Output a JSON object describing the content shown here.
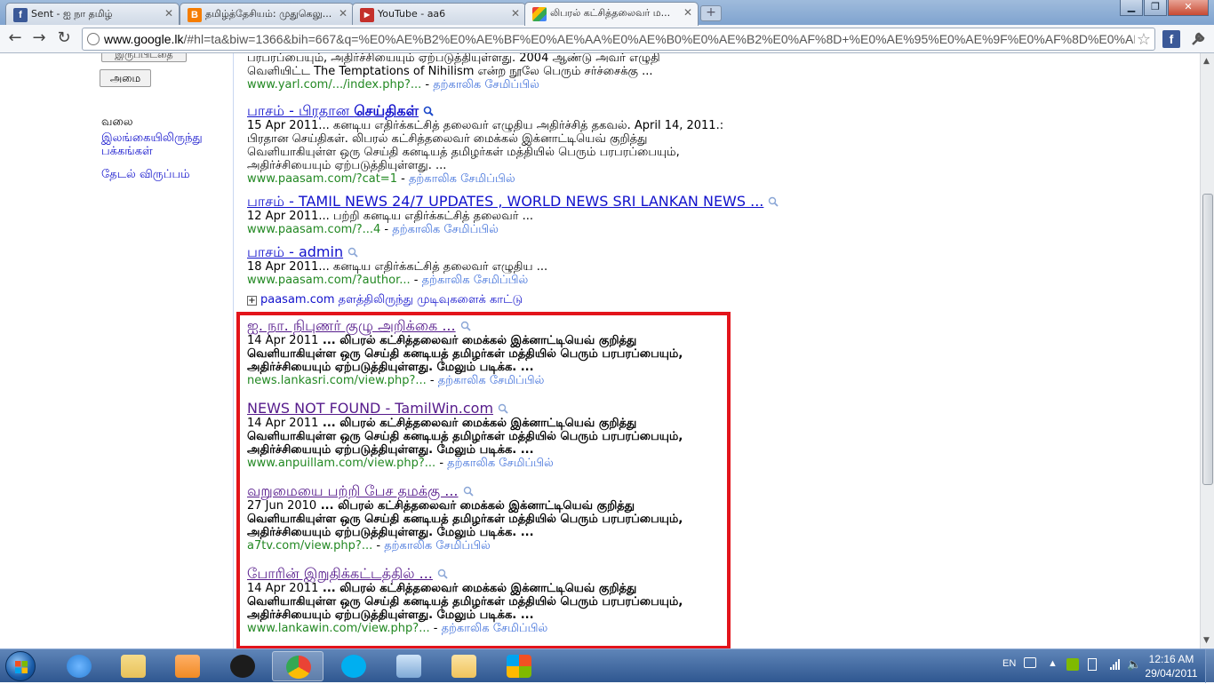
{
  "tabs": [
    {
      "title": "Sent - ஐ நா தமிழ்",
      "favicon": "facebook-icon",
      "color": "#3b5998",
      "glyph": "f"
    },
    {
      "title": "தமிழ்த்தேசியம்: முதுகெலு...",
      "favicon": "blogger-icon",
      "color": "#f57d00",
      "glyph": "B"
    },
    {
      "title": "YouTube - aa6",
      "favicon": "youtube-icon",
      "color": "#c4302b",
      "glyph": "▶"
    },
    {
      "title": "லிபரல் கட்சித்தலைவர் ம...",
      "favicon": "google-icon",
      "color": "#3b82f6",
      "glyph": "g"
    }
  ],
  "address": {
    "host": "www.google.lk",
    "path": "/#hl=ta&biw=1366&bih=667&q=%E0%AE%B2%E0%AE%BF%E0%AE%AA%E0%AE%B0%E0%AE%B2%E0%AF%8D+%E0%AE%95%E0%AE%9F%E0%AF%8D%E0%AE%"
  },
  "sidebar": {
    "partial_label": "இருப்பிடதை",
    "set_button": "அமை",
    "web_heading": "வலை",
    "links": [
      "இலங்கையிலிருந்து பக்கங்கள்",
      "தேடல் விருப்பம்"
    ]
  },
  "cached_label": "தற்காலிக சேமிப்பில்",
  "top_partial": {
    "line1": "பரபரப்பையும், அதிர்ச்சியையும் ஏற்படுத்தியுள்ளது. 2004 ஆண்டு அவர் எழுதி",
    "line2": "வெளியிட்ட The Temptations of Nihilism என்ற நூலே பெரும் சர்ச்சைக்கு ...",
    "cite": "www.yarl.com/.../index.php?..."
  },
  "results": [
    {
      "title_plain": "பாசம் - பிரதான ",
      "title_bold": "செய்திகள்",
      "snippet": "15 Apr 2011... கனடிய எதிர்க்கட்சித் தலைவர் எழுதிய அதிர்ச்சித் தகவல். April 14, 2011.: பிரதான செய்திகள். லிபரல் கட்சித்தலைவர் மைக்கல் இக்னாட்டியெவ் குறித்து வெளியாகியுள்ள ஒரு செய்தி கனடியத் தமிழர்கள் மத்தியில் பெரும் பரபரப்பையும், அதிர்ச்சியையும் ஏற்படுத்தியுள்ளது. ...",
      "cite": "www.paasam.com/?cat=1"
    },
    {
      "title_plain": "பாசம் - TAMIL NEWS 24/7 UPDATES , WORLD NEWS SRI LANKAN NEWS ...",
      "title_bold": "",
      "snippet": "12 Apr 2011... பற்றி கனடிய எதிர்க்கட்சித் தலைவர் ...",
      "cite": "www.paasam.com/?...4"
    },
    {
      "title_plain": "பாசம் - admin",
      "title_bold": "",
      "snippet": "18 Apr 2011... கனடிய எதிர்க்கட்சித் தலைவர் எழுதிய ...",
      "cite": "www.paasam.com/?author..."
    }
  ],
  "more_from_site": {
    "site": "paasam.com",
    "text": "தளத்திலிருந்து முடிவுகளைக் காட்டு"
  },
  "highlighted_results": [
    {
      "title": "ஐ. நா. நிபுணர் குழு அறிக்கை ...",
      "visited": true,
      "date": "14 Apr 2011",
      "snippet": "... லிபரல் கட்சித்தலைவர் மைக்கல் இக்னாட்டியெவ் குறித்து வெளியாகியுள்ள ஒரு செய்தி கனடியத் தமிழர்கள் மத்தியில் பெரும் பரபரப்பையும், அதிர்ச்சியையும் ஏற்படுத்தியுள்ளது. மேலும் படிக்க. ...",
      "cite": "news.lankasri.com/view.php?..."
    },
    {
      "title": "NEWS NOT FOUND - TamilWin.com",
      "visited": true,
      "date": "14 Apr 2011",
      "snippet": "... லிபரல் கட்சித்தலைவர் மைக்கல் இக்னாட்டியெவ் குறித்து வெளியாகியுள்ள ஒரு செய்தி கனடியத் தமிழர்கள் மத்தியில் பெரும் பரபரப்பையும், அதிர்ச்சியையும் ஏற்படுத்தியுள்ளது. மேலும் படிக்க. ...",
      "cite": "www.anpuillam.com/view.php?..."
    },
    {
      "title": "வறுமையை பற்றி பேச தமக்கு ...",
      "visited": true,
      "date": "27 Jun 2010",
      "snippet": "... லிபரல் கட்சித்தலைவர் மைக்கல் இக்னாட்டியெவ் குறித்து வெளியாகியுள்ள ஒரு செய்தி கனடியத் தமிழர்கள் மத்தியில் பெரும் பரபரப்பையும், அதிர்ச்சியையும் ஏற்படுத்தியுள்ளது. மேலும் படிக்க. ...",
      "cite": "a7tv.com/view.php?..."
    },
    {
      "title": "போரின் இறுதிக்கட்டத்தில் ...",
      "visited": true,
      "date": "14 Apr 2011",
      "snippet": "... லிபரல் கட்சித்தலைவர் மைக்கல் இக்னாட்டியெவ் குறித்து வெளியாகியுள்ள ஒரு செய்தி கனடியத் தமிழர்கள் மத்தியில் பெரும் பரபரப்பையும், அதிர்ச்சியையும் ஏற்படுத்தியுள்ளது. மேலும் படிக்க. ...",
      "cite": "www.lankawin.com/view.php?..."
    }
  ],
  "taskbar": {
    "apps": [
      {
        "name": "internet-explorer-icon",
        "color": "#2b7fd6"
      },
      {
        "name": "explorer-folder-icon",
        "color": "#e8c15a"
      },
      {
        "name": "media-player-icon",
        "color": "#f08a24"
      },
      {
        "name": "hp-icon",
        "color": "#1c1c1c"
      },
      {
        "name": "chrome-icon",
        "color": "#4caf50"
      },
      {
        "name": "skype-icon",
        "color": "#00aff0"
      },
      {
        "name": "picture-viewer-icon",
        "color": "#7fa9d6"
      },
      {
        "name": "outlook-icon",
        "color": "#f0c35c"
      },
      {
        "name": "windows-icon",
        "color": "#f25022"
      }
    ],
    "language": "EN",
    "time": "12:16 AM",
    "date": "29/04/2011"
  },
  "colors": {
    "highlight_border": "#e3141b",
    "link": "#1111cc",
    "visited": "#551a8b",
    "cite": "#228822"
  }
}
